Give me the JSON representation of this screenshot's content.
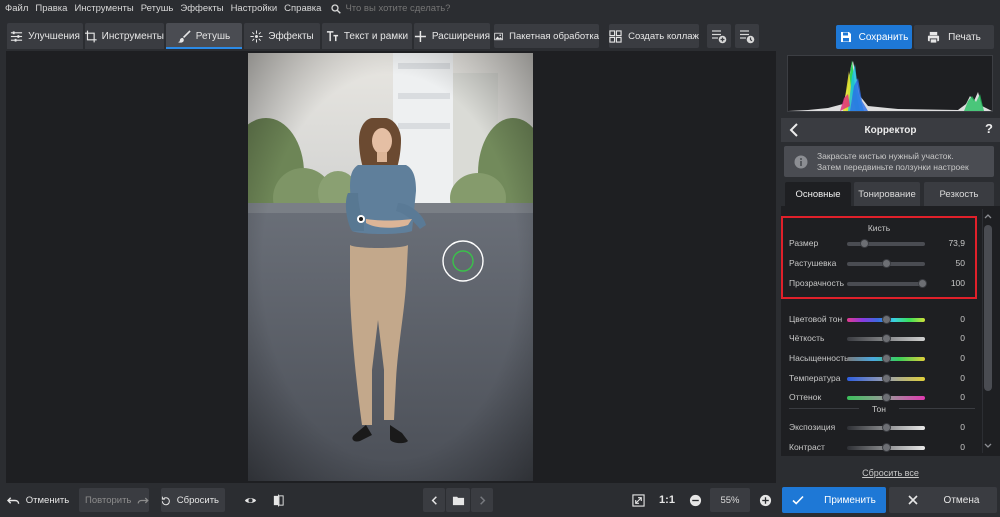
{
  "menu": {
    "items": [
      "Файл",
      "Правка",
      "Инструменты",
      "Ретушь",
      "Эффекты",
      "Настройки",
      "Справка"
    ],
    "search_placeholder": "Что вы хотите сделать?"
  },
  "toolbar": {
    "tabs": [
      {
        "label": "Улучшения",
        "icon": "sliders-icon"
      },
      {
        "label": "Инструменты",
        "icon": "crop-icon"
      },
      {
        "label": "Ретушь",
        "icon": "brush-icon",
        "active": true
      },
      {
        "label": "Эффекты",
        "icon": "sparkle-icon"
      },
      {
        "label": "Текст и рамки",
        "icon": "text-icon"
      },
      {
        "label": "Расширения",
        "icon": "plus-icon"
      }
    ],
    "batch_label": "Пакетная обработка",
    "collage_label": "Создать коллаж",
    "save_label": "Сохранить",
    "print_label": "Печать"
  },
  "panel": {
    "title": "Корректор",
    "help": "?",
    "hint_line1": "Закрасьте кистью нужный участок.",
    "hint_line2": "Затем передвиньте ползунки настроек",
    "subtabs": [
      "Основные",
      "Тонирование",
      "Резкость"
    ],
    "active_subtab": "Основные",
    "brush": {
      "title": "Кисть",
      "rows": [
        {
          "label": "Размер",
          "value": "73,9",
          "fraction": 0.22
        },
        {
          "label": "Растушевка",
          "value": "50",
          "fraction": 0.5
        },
        {
          "label": "Прозрачность",
          "value": "100",
          "fraction": 0.96
        }
      ]
    },
    "color_rows": [
      {
        "label": "Цветовой тон",
        "value": "0",
        "gradient": "hue"
      },
      {
        "label": "Чёткость",
        "value": "0",
        "gradient": "gray"
      },
      {
        "label": "Насыщенность",
        "value": "0",
        "gradient": "sat"
      },
      {
        "label": "Температура",
        "value": "0",
        "gradient": "temp"
      },
      {
        "label": "Оттенок",
        "value": "0",
        "gradient": "tint"
      }
    ],
    "tone": {
      "title": "Тон",
      "rows": [
        {
          "label": "Экспозиция",
          "value": "0",
          "fraction": 0.5
        },
        {
          "label": "Контраст",
          "value": "0",
          "fraction": 0.5
        }
      ]
    },
    "reset_label": "Сбросить все"
  },
  "bottom": {
    "undo_label": "Отменить",
    "redo_label": "Повторить",
    "reset_label": "Сбросить",
    "one_to_one": "1:1",
    "zoom_value": "55%",
    "apply_label": "Применить",
    "cancel_label": "Отмена"
  },
  "colors": {
    "accent": "#1e78d6",
    "highlight_box": "#e0202a",
    "brush_circle": "#3ac24a"
  }
}
